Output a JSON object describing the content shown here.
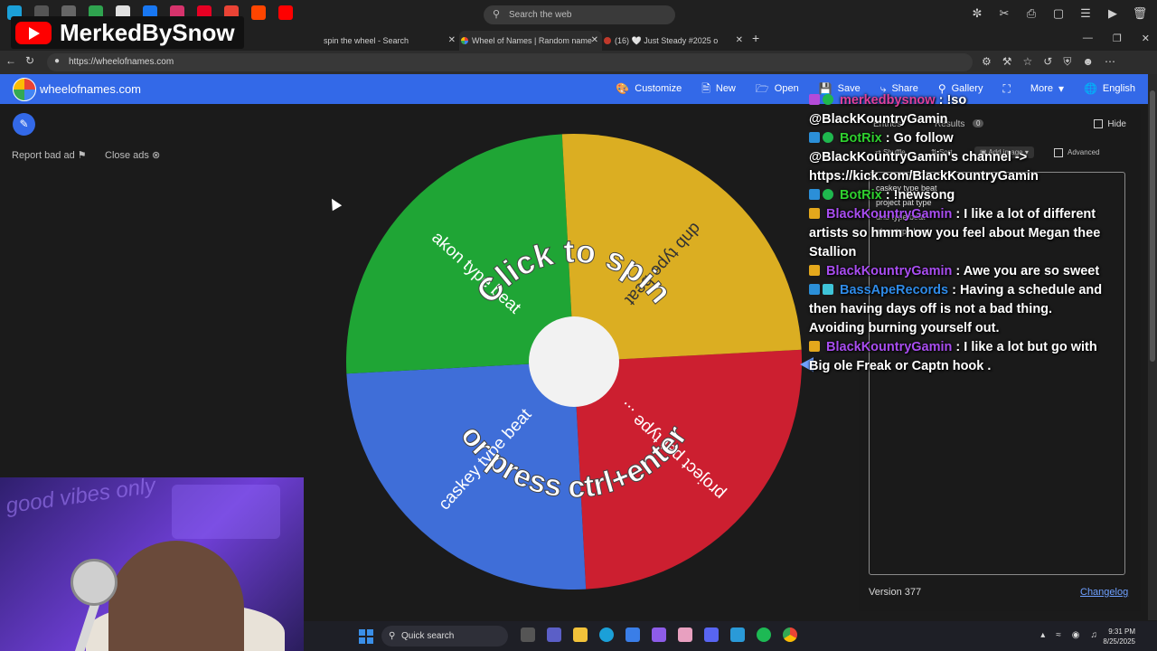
{
  "browser": {
    "search_placeholder": "Search the web",
    "url": "https://wheelofnames.com",
    "tabs": [
      {
        "title": "spin the wheel - Search"
      },
      {
        "title": "Wheel of Names | Random name"
      },
      {
        "title": "(16) 🤍 Just Steady #2025 o"
      }
    ]
  },
  "header": {
    "site_title": "wheelofnames.com",
    "nav": [
      "Customize",
      "New",
      "Open",
      "Save",
      "Share",
      "Gallery",
      "More",
      "English"
    ]
  },
  "left_tools": {
    "report_ad": "Report bad ad",
    "close_ads": "Close ads"
  },
  "wheel": {
    "spin_text": "Click to spin",
    "press_text": "or press ctrl+enter",
    "slices": [
      {
        "label": "project pat type ...",
        "color": "#cc1f30"
      },
      {
        "label": "caskey type beat",
        "color": "#3f6ed8"
      },
      {
        "label": "akon type beat",
        "color": "#1fa535"
      },
      {
        "label": "dnb type beat",
        "color": "#dbae22"
      }
    ]
  },
  "entries_panel": {
    "tab_entries": "Entries",
    "tab_results": "Results",
    "results_count": "0",
    "hide_label": "Hide",
    "shuffle_label": "Shuffle",
    "sort_label": "Sort",
    "add_image_label": "Add image",
    "advanced_label": "Advanced",
    "entries": [
      "caskey type beat",
      "project pat type",
      "dnb type beat",
      "akon type beat"
    ],
    "version": "Version 377",
    "changelog": "Changelog"
  },
  "chat": [
    {
      "user": "merkedbysnow",
      "user_color": "#e0409a",
      "text": " : !so @BlackKountryGamin"
    },
    {
      "user": "BotRix",
      "user_color": "#2fd12f",
      "text": " : Go follow @BlackKountryGamin's channel -> https://kick.com/BlackKountryGamin"
    },
    {
      "user": "BotRix",
      "user_color": "#2fd12f",
      "text": " : !newsong"
    },
    {
      "user": "BlackKountryGamin",
      "user_color": "#a84df0",
      "text": " : I like a lot of different artists so hmm how you feel about Megan thee Stallion"
    },
    {
      "user": "BlackKountryGamin",
      "user_color": "#a84df0",
      "text": " : Awe you are so sweet"
    },
    {
      "user": "BassApeRecords",
      "user_color": "#2f8be8",
      "text": " : Having a schedule and then having days off is not a bad thing. Avoiding burning yourself out."
    },
    {
      "user": "BlackKountryGamin",
      "user_color": "#a84df0",
      "text": " : I like a lot but go with Big ole Freak or Captn hook ."
    }
  ],
  "overlay": {
    "channel_name": "MerkedBySnow",
    "webcam_text": "good vibes only"
  },
  "taskbar": {
    "search_label": "Quick search",
    "time": "9:31 PM",
    "date": "8/25/2025"
  },
  "colors": {
    "header_blue": "#3369e8",
    "link_blue": "#6ea0ff"
  }
}
